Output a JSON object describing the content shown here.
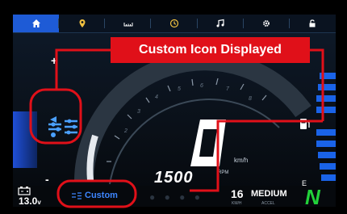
{
  "controls": {
    "plus": "+",
    "minus": "-"
  },
  "speed": {
    "unit": "km/h"
  },
  "rpm": {
    "value": "1500",
    "unit": "RPM"
  },
  "fuel": {
    "empty_label": "E"
  },
  "status": {
    "voltage_value": "13.0",
    "voltage_unit": "v",
    "riding_mode": "Custom",
    "tc_value": "16",
    "tc_label": "KM/H",
    "accel_value": "MEDIUM",
    "accel_label": "ACCEL",
    "neutral": "N"
  },
  "annotation": {
    "callout": "Custom Icon Displayed"
  },
  "icons": [
    "home-icon",
    "location-pin-icon",
    "gauge-scale-icon",
    "clock-icon",
    "music-note-icon",
    "gear-icon",
    "unlock-icon",
    "custom-mode-icon",
    "fuel-pump-icon",
    "battery-icon"
  ],
  "colors": {
    "accent_blue": "#1e5bd6",
    "annotation_red": "#e01019",
    "neutral_green": "#22d13a",
    "mode_blue": "#3d86ff"
  }
}
